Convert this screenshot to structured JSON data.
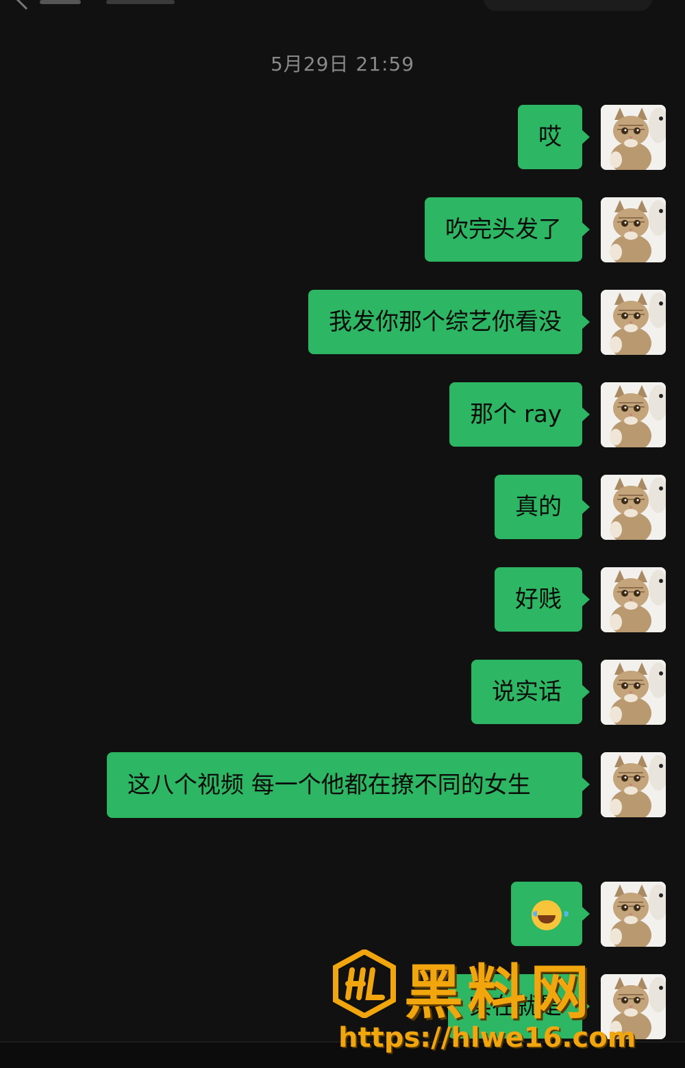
{
  "timestamp": "5月29日 21:59",
  "messages": [
    {
      "text": "哎"
    },
    {
      "text": "吹完头发了"
    },
    {
      "text": "我发你那个综艺你看没"
    },
    {
      "text": "那个 ray"
    },
    {
      "text": "真的"
    },
    {
      "text": "好贱"
    },
    {
      "text": "说实话"
    },
    {
      "text": "这八个视频 每一个他都在撩不同的女生"
    },
    {
      "text": "",
      "emoji": "face-with-tears-of-joy"
    },
    {
      "text": "实在就是"
    }
  ],
  "avatar_icon": "cat-dog-avatar",
  "bubble_color": "#2db663",
  "background_color": "#111111",
  "watermark": {
    "title": "黑料网",
    "url": "https://hlwe16.com",
    "color": "#f2a60d"
  }
}
